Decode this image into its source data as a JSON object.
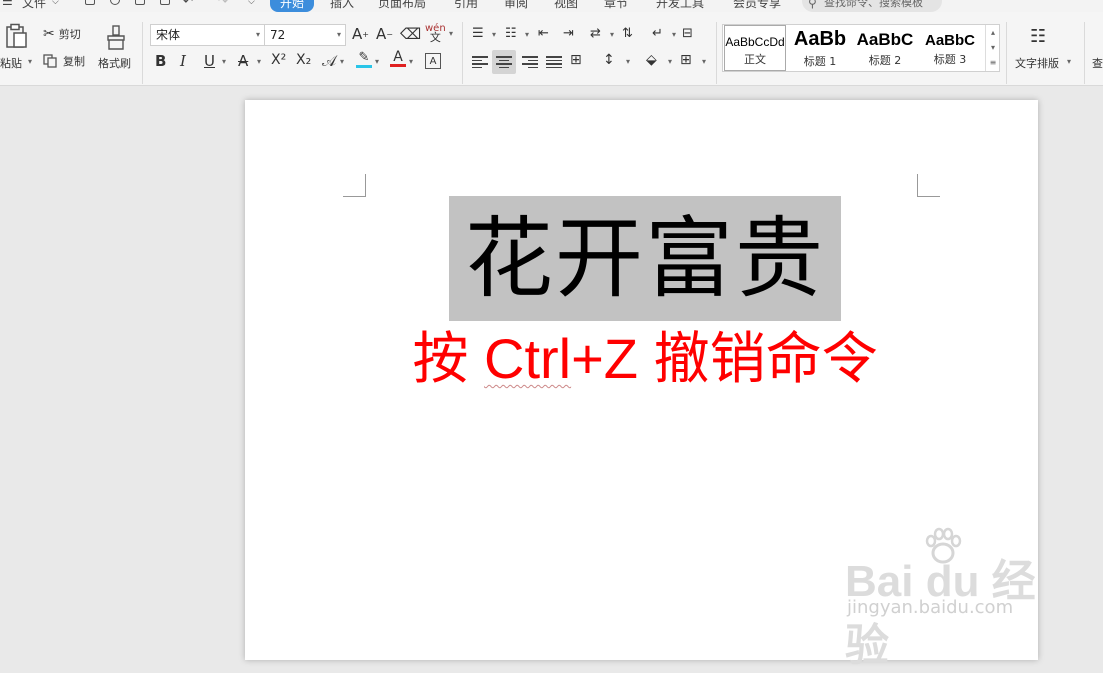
{
  "menubar": {
    "file": "文件",
    "tabs": [
      "开始",
      "插入",
      "页面布局",
      "引用",
      "审阅",
      "视图",
      "章节",
      "开发工具",
      "会员专享"
    ],
    "active_tab": "开始",
    "search_placeholder": "查找命令、搜索模板"
  },
  "clipboard": {
    "paste": "粘贴",
    "cut": "剪切",
    "copy": "复制",
    "format_painter": "格式刷"
  },
  "font": {
    "name": "宋体",
    "size": "72",
    "bold": "B",
    "italic": "I",
    "underline": "U",
    "strike": "A",
    "superscript": "X²",
    "subscript": "X₂",
    "phonetic": "wén",
    "font_color_accent": "#e02020",
    "highlight_accent": "#2ac5e8"
  },
  "styles": {
    "items": [
      {
        "sample": "AaBbCcDd",
        "name": "正文"
      },
      {
        "sample": "AaBb",
        "name": "标题 1"
      },
      {
        "sample": "AaBbC",
        "name": "标题 2"
      },
      {
        "sample": "AaBbC",
        "name": "标题 3"
      }
    ],
    "text_layout": "文字排版",
    "search_cmd": "查"
  },
  "document": {
    "title": "花开富贵",
    "instruction_prefix": "按 ",
    "instruction_key": "Ctrl",
    "instruction_mid": "+Z ",
    "instruction_suffix": "撤销命令",
    "title_color": "#000000",
    "instruction_color": "#ff0000"
  },
  "watermark": {
    "brand": "Bai du 经验",
    "url": "jingyan.baidu.com"
  }
}
